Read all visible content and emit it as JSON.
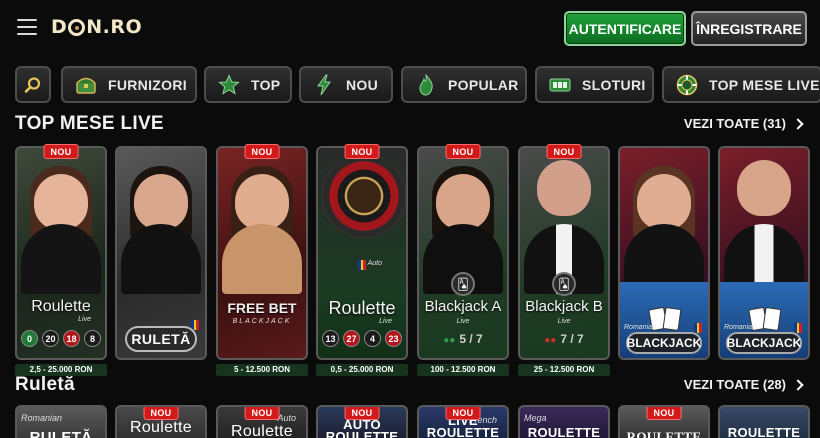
{
  "header": {
    "logo": "D N.RO",
    "logo_left": "D",
    "logo_right": "N.RO",
    "login_label": "AUTENTIFICARE",
    "register_label": "ÎNREGISTRARE"
  },
  "categories": [
    {
      "label": "FURNIZORI",
      "icon": "chest-icon"
    },
    {
      "label": "TOP",
      "icon": "star-icon"
    },
    {
      "label": "NOU",
      "icon": "lightning-icon"
    },
    {
      "label": "POPULAR",
      "icon": "flame-icon"
    },
    {
      "label": "SLOTURI",
      "icon": "slot-icon"
    },
    {
      "label": "TOP MESE LIVE",
      "icon": "chip-icon"
    }
  ],
  "sections": {
    "top_live": {
      "title": "TOP MESE LIVE",
      "see_all": "VEZI TOATE (31)"
    },
    "ruleta": {
      "title": "Ruletă",
      "see_all": "VEZI TOATE (28)"
    }
  },
  "badge_new": "NOU",
  "top_live_cards": [
    {
      "title": "Roulette",
      "sub": "Live",
      "numbers": [
        "0",
        "20",
        "18",
        "8"
      ],
      "limits": "2,5 - 25.000 RON",
      "new": true
    },
    {
      "title": "RULETĂ",
      "sub": "Romanian",
      "limits": "",
      "new": false
    },
    {
      "title": "FREE BET",
      "sub": "BLACKJACK",
      "limits": "5 - 12.500 RON",
      "new": true
    },
    {
      "title": "Roulette",
      "sub": "Live",
      "pre": "Auto",
      "numbers": [
        "13",
        "27",
        "4",
        "23"
      ],
      "limits": "0,5 - 25.000 RON",
      "new": true
    },
    {
      "title": "Blackjack A",
      "sub": "Live",
      "seats": "5 / 7",
      "limits": "100 - 12.500 RON",
      "new": true
    },
    {
      "title": "Blackjack B",
      "sub": "Live",
      "seats": "7 / 7",
      "limits": "25 - 12.500 RON",
      "new": true
    },
    {
      "title": "BLACKJACK",
      "sub": "Romanian",
      "limits": "",
      "new": false
    },
    {
      "title": "BLACKJACK",
      "sub": "Romanian",
      "limits": "",
      "new": false
    }
  ],
  "ruleta_cards": [
    {
      "title": "RULETĂ",
      "pre": "Romanian",
      "new": false
    },
    {
      "title": "Roulette",
      "new": true
    },
    {
      "title": "Roulette",
      "pre": "Auto",
      "new": true
    },
    {
      "title": "AUTO ROULETTE",
      "new": true
    },
    {
      "title": "LIVE ROULETTE",
      "pre": "French",
      "new": true
    },
    {
      "title": "ROULETTE",
      "pre": "Mega",
      "new": false
    },
    {
      "title": "ROULETTE",
      "new": true
    },
    {
      "title": "ROULETTE",
      "new": false
    }
  ],
  "colors": {
    "login_green": "#1fa23a",
    "badge_red": "#d21a1a",
    "background": "#0b0b0c"
  }
}
